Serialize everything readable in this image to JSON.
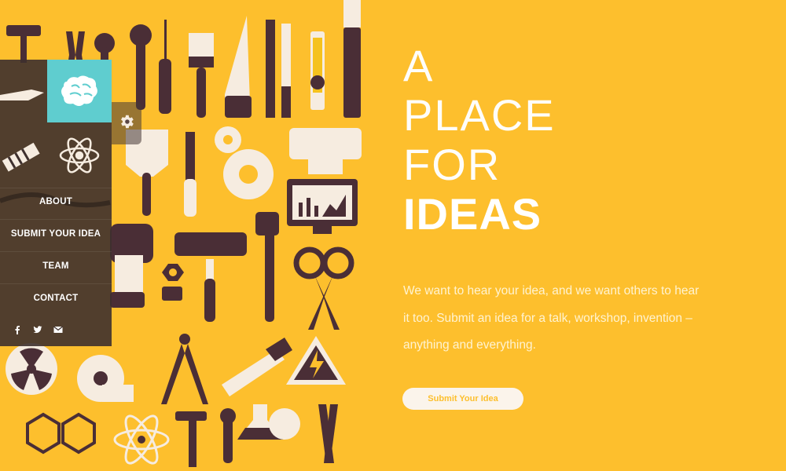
{
  "colors": {
    "background": "#FDBF2D",
    "sidebar": "#3E302E",
    "accent_teal": "#5FCDCF",
    "tool_dark": "#4A2E36",
    "tool_light": "#F6ECE0"
  },
  "nav": {
    "items": [
      {
        "label": "ABOUT"
      },
      {
        "label": "SUBMIT YOUR IDEA"
      },
      {
        "label": "TEAM"
      },
      {
        "label": "CONTACT"
      }
    ],
    "icons": {
      "top_left": "knife-icon",
      "brain": "brain-icon",
      "gear": "gear-icon",
      "pencil": "pencil-icon",
      "atom": "atom-icon",
      "pliers": "pliers-icon",
      "saw": "saw-icon"
    },
    "social": [
      "facebook-icon",
      "twitter-icon",
      "email-icon"
    ]
  },
  "hero": {
    "line1": "A",
    "line2": "PLACE",
    "line3": "FOR",
    "line4": "IDEAS",
    "lead": "We want to hear your idea, and we want others to hear it too. Submit an idea for a talk, workshop, invention – anything and everything.",
    "cta_label": "Submit Your Idea"
  }
}
